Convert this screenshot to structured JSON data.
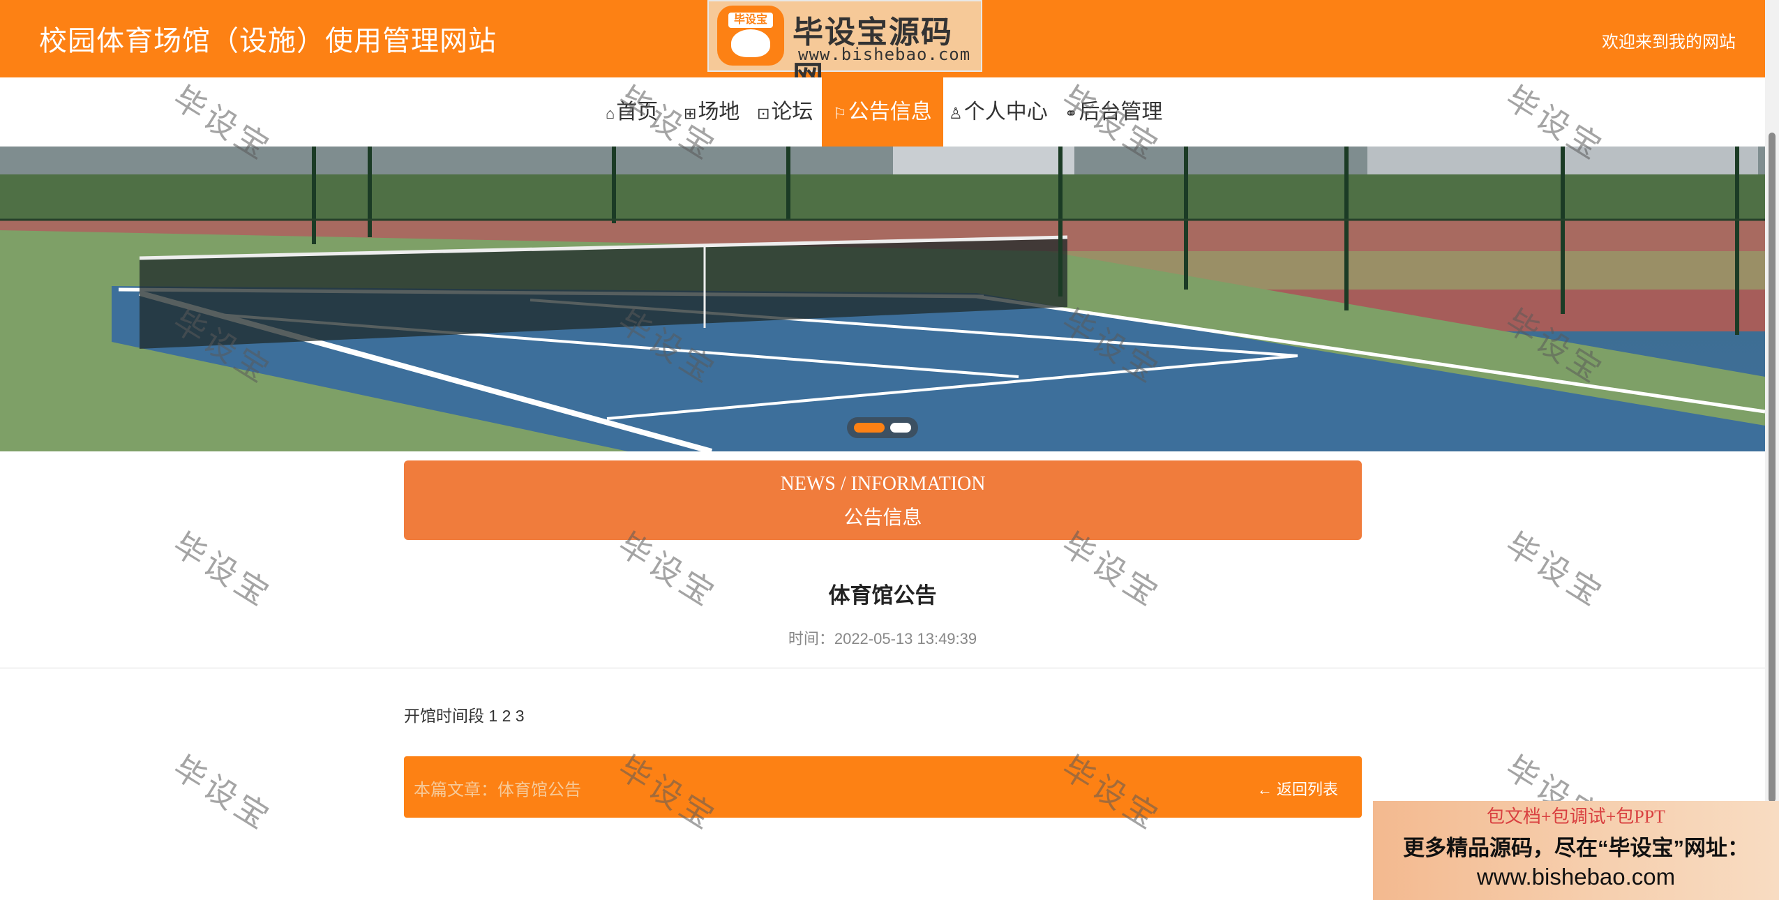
{
  "header": {
    "site_title": "校园体育场馆（设施）使用管理网站",
    "welcome": "欢迎来到我的网站",
    "logo": {
      "brand": "毕设宝源码网",
      "url": "www.bishebao.com",
      "badge": "毕设宝"
    }
  },
  "nav": [
    {
      "label": "首页",
      "icon": "home-icon",
      "glyph": "⌂",
      "active": false
    },
    {
      "label": "场地",
      "icon": "venue-icon",
      "glyph": "⊞",
      "active": false
    },
    {
      "label": "论坛",
      "icon": "forum-icon",
      "glyph": "⊡",
      "active": false
    },
    {
      "label": "公告信息",
      "icon": "flag-icon",
      "glyph": "⚐",
      "active": true
    },
    {
      "label": "个人中心",
      "icon": "user-icon",
      "glyph": "♙",
      "active": false
    },
    {
      "label": "后台管理",
      "icon": "link-icon",
      "glyph": "⚭",
      "active": false
    }
  ],
  "carousel": {
    "slides": 2,
    "active_index": 0
  },
  "news": {
    "en": "NEWS / INFORMATION",
    "cn": "公告信息"
  },
  "article": {
    "title": "体育馆公告",
    "time": "时间：2022-05-13 13:49:39",
    "body": "开馆时间段 1 2 3"
  },
  "bottom": {
    "current": "本篇文章：体育馆公告",
    "back": "返回列表",
    "back_icon": "arrow-left-icon"
  },
  "watermark": "毕设宝",
  "ad": {
    "line1": "包文档+包调试+包PPT",
    "line2": "更多精品源码，尽在“毕设宝”网址：",
    "line3": "www.bishebao.com"
  },
  "colors": {
    "accent": "#fd8114",
    "newsbar": "#f07c3c"
  }
}
